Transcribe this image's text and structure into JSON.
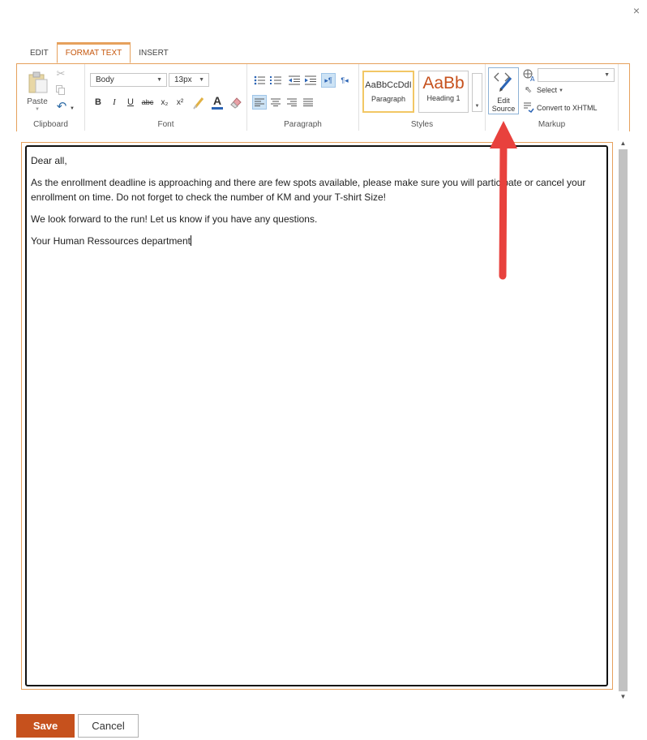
{
  "dialog": {
    "close_glyph": "×"
  },
  "tabs": [
    {
      "label": "EDIT",
      "active": false
    },
    {
      "label": "FORMAT TEXT",
      "active": true
    },
    {
      "label": "INSERT",
      "active": false
    }
  ],
  "ribbon": {
    "clipboard": {
      "label": "Clipboard",
      "paste_label": "Paste"
    },
    "font": {
      "label": "Font",
      "font_family": "Body",
      "font_size": "13px",
      "bold": "B",
      "italic": "I",
      "underline": "U",
      "strikethrough": "abc",
      "subscript": "x₂",
      "superscript": "x²",
      "text_color_letter": "A"
    },
    "paragraph": {
      "label": "Paragraph"
    },
    "styles": {
      "label": "Styles",
      "tiles": [
        {
          "sample": "AaBbCcDdI",
          "name": "Paragraph"
        },
        {
          "sample": "AaBb",
          "name": "Heading 1"
        }
      ]
    },
    "markup": {
      "label": "Markup",
      "edit_source_line1": "Edit",
      "edit_source_line2": "Source",
      "select_label": "Select",
      "convert_label": "Convert to XHTML",
      "language_value": ""
    }
  },
  "editor": {
    "paragraphs": [
      "Dear all,",
      "As the enrollment deadline is approaching and there are few spots available, please make sure you will participate or cancel your enrollment on time. Do not forget to check the number of KM and your T-shirt Size!",
      "We look forward to the run! Let us know if you have any questions.",
      "Your Human Ressources department"
    ]
  },
  "footer": {
    "save_label": "Save",
    "cancel_label": "Cancel"
  },
  "colors": {
    "accent": "#c6511d",
    "ribbon_border": "#e6a15d",
    "annotation_arrow": "#e8413d"
  }
}
